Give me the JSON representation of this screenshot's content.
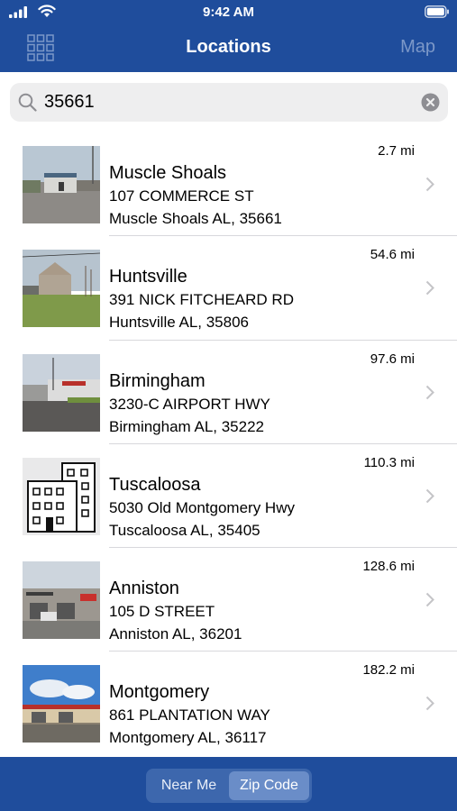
{
  "status_bar": {
    "time": "9:42 AM"
  },
  "nav": {
    "title": "Locations",
    "right_action": "Map",
    "left_icon": "grid-icon"
  },
  "search": {
    "value": "35661",
    "placeholder": "Search"
  },
  "locations": [
    {
      "name": "Muscle Shoals",
      "address": "107 COMMERCE ST",
      "city": "Muscle Shoals AL, 35661",
      "distance": "2.7 mi"
    },
    {
      "name": "Huntsville",
      "address": "391 NICK FITCHEARD RD",
      "city": "Huntsville AL, 35806",
      "distance": "54.6 mi"
    },
    {
      "name": "Birmingham",
      "address": "3230-C AIRPORT HWY",
      "city": "Birmingham AL, 35222",
      "distance": "97.6 mi"
    },
    {
      "name": "Tuscaloosa",
      "address": "5030 Old Montgomery Hwy",
      "city": "Tuscaloosa AL, 35405",
      "distance": "110.3 mi"
    },
    {
      "name": "Anniston",
      "address": "105 D STREET",
      "city": "Anniston AL, 36201",
      "distance": "128.6 mi"
    },
    {
      "name": "Montgomery",
      "address": "861 PLANTATION WAY",
      "city": "Montgomery AL, 36117",
      "distance": "182.2 mi"
    }
  ],
  "segments": [
    {
      "label": "Near Me",
      "active": false
    },
    {
      "label": "Zip Code",
      "active": true
    }
  ],
  "colors": {
    "brand": "#1f4d9c",
    "segment_active": "#6a8dc8"
  }
}
